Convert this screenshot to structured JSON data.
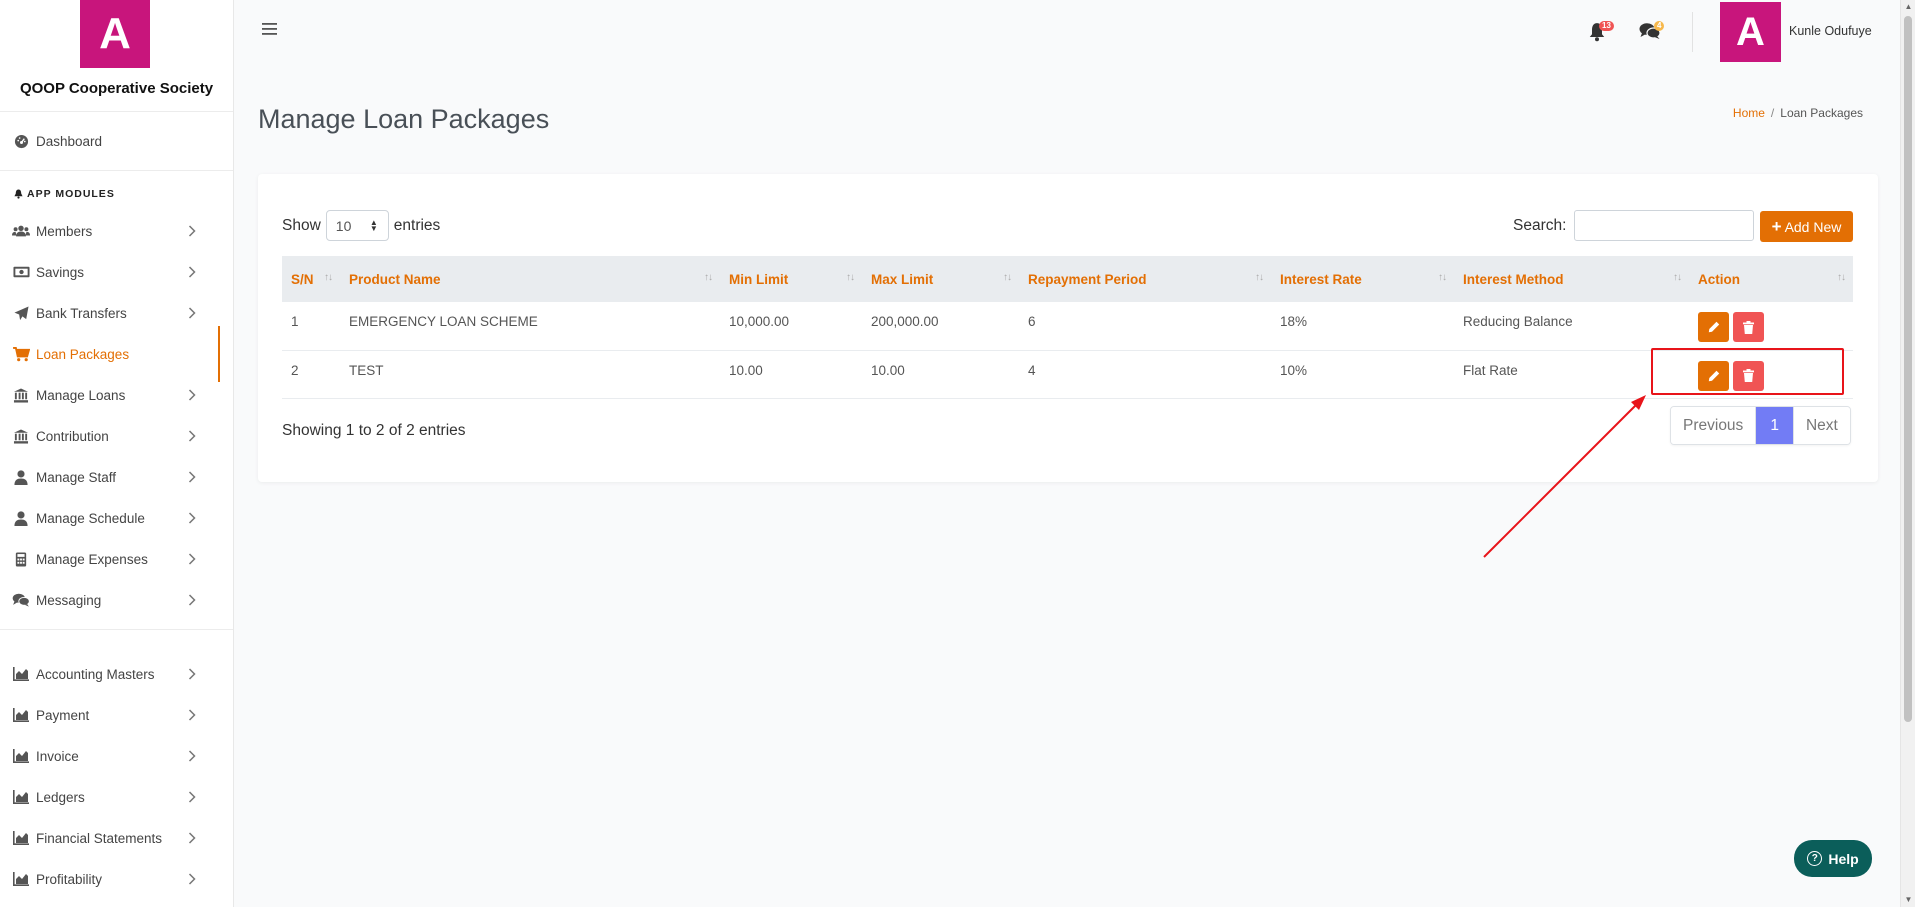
{
  "brand": {
    "logo_letter": "A",
    "name": "QOOP Cooperative Society"
  },
  "sidebar": {
    "dashboard": "Dashboard",
    "section_label": "APP MODULES",
    "items": [
      {
        "label": "Members",
        "icon": "users-icon"
      },
      {
        "label": "Savings",
        "icon": "money-bill-icon"
      },
      {
        "label": "Bank Transfers",
        "icon": "paper-plane-icon"
      },
      {
        "label": "Loan Packages",
        "icon": "cart-icon",
        "active": true
      },
      {
        "label": "Manage Loans",
        "icon": "bank-icon"
      },
      {
        "label": "Contribution",
        "icon": "bank-icon"
      },
      {
        "label": "Manage Staff",
        "icon": "user-icon"
      },
      {
        "label": "Manage Schedule",
        "icon": "user-icon"
      },
      {
        "label": "Manage Expenses",
        "icon": "calculator-icon"
      },
      {
        "label": "Messaging",
        "icon": "comments-icon"
      }
    ],
    "accounting_items": [
      {
        "label": "Accounting Masters",
        "icon": "chart-area-icon"
      },
      {
        "label": "Payment",
        "icon": "chart-area-icon"
      },
      {
        "label": "Invoice",
        "icon": "chart-area-icon"
      },
      {
        "label": "Ledgers",
        "icon": "chart-area-icon"
      },
      {
        "label": "Financial Statements",
        "icon": "chart-area-icon"
      },
      {
        "label": "Profitability",
        "icon": "chart-area-icon"
      }
    ]
  },
  "topbar": {
    "notifications_count": "13",
    "messages_count": "4",
    "avatar_letter": "A",
    "username": "Kunle Odufuye"
  },
  "page": {
    "title": "Manage Loan Packages",
    "breadcrumb": {
      "home": "Home",
      "sep": "/",
      "current": "Loan Packages"
    }
  },
  "table_controls": {
    "show_label": "Show",
    "entries_value": "10",
    "entries_label": "entries",
    "search_label": "Search:",
    "search_value": "",
    "add_new_label": "Add New"
  },
  "table": {
    "columns": [
      "S/N",
      "Product Name",
      "Min Limit",
      "Max Limit",
      "Repayment Period",
      "Interest Rate",
      "Interest Method",
      "Action"
    ],
    "rows": [
      [
        "1",
        "EMERGENCY LOAN SCHEME",
        "10,000.00",
        "200,000.00",
        "6",
        "18%",
        "Reducing Balance"
      ],
      [
        "2",
        "TEST",
        "10.00",
        "10.00",
        "4",
        "10%",
        "Flat Rate"
      ]
    ]
  },
  "footer_info": "Showing 1 to 2 of 2 entries",
  "pagination": {
    "previous": "Previous",
    "current": "1",
    "next": "Next"
  },
  "help_label": "Help",
  "colors": {
    "accent": "#e36f04",
    "brand": "#c8157c",
    "danger": "#f05454",
    "pager_active": "#727cf5",
    "help": "#0b5e5a",
    "annotation": "#e8141a"
  }
}
